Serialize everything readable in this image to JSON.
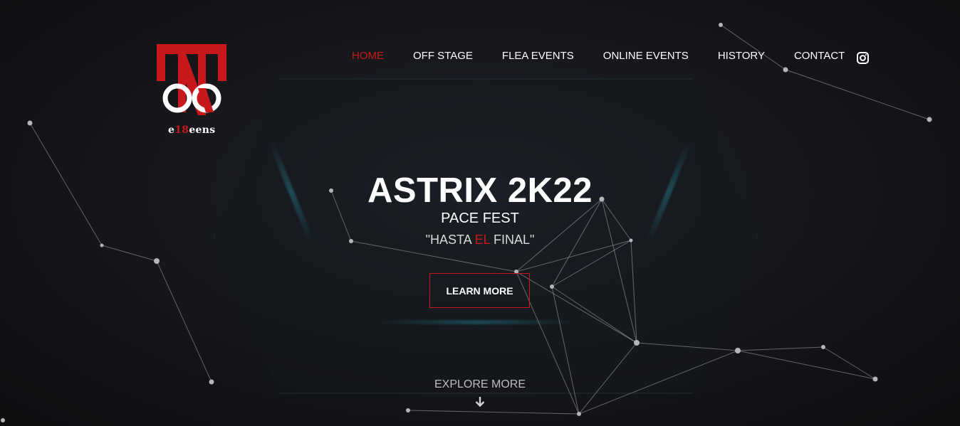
{
  "logo": {
    "brand_prefix": "e",
    "brand_number": "18",
    "brand_suffix": "eens"
  },
  "nav": {
    "items": [
      {
        "label": "HOME",
        "active": true
      },
      {
        "label": "OFF STAGE",
        "active": false
      },
      {
        "label": "FLEA EVENTS",
        "active": false
      },
      {
        "label": "ONLINE EVENTS",
        "active": false
      },
      {
        "label": "HISTORY",
        "active": false
      },
      {
        "label": "CONTACT",
        "active": false
      }
    ],
    "social_icon": "instagram-icon"
  },
  "hero": {
    "title": "ASTRIX 2K22",
    "subtitle": "PACE FEST",
    "tagline_open": "\"HASTA ",
    "tagline_highlight": "EL",
    "tagline_close": " FINAL\"",
    "cta_label": "LEARN MORE",
    "explore_label": "EXPLORE MORE",
    "explore_icon": "arrow-down-icon"
  },
  "colors": {
    "accent": "#c8181c",
    "background": "#121316",
    "text": "#ffffff"
  }
}
